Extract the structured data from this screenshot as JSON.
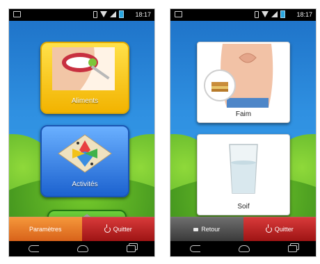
{
  "left_screen": {
    "status_time": "18:17",
    "tiles": [
      {
        "label": "Aliments"
      },
      {
        "label": "Activités"
      }
    ],
    "bottom_bar": {
      "left_label": "Paramètres",
      "right_label": "Quitter"
    }
  },
  "right_screen": {
    "status_time": "18:17",
    "tiles": [
      {
        "label": "Faim"
      },
      {
        "label": "Soif"
      }
    ],
    "bottom_bar": {
      "left_label": "Retour",
      "right_label": "Quitter"
    }
  },
  "colors": {
    "sky": "#2f90e1",
    "hills": "#3f9f1f",
    "aliments_tile": "#f7c81a",
    "activites_tile": "#2a72d8",
    "parametres_button": "#e57a28",
    "quitter_button": "#b52020",
    "retour_button": "#4e4e4e"
  },
  "icons": [
    "vibrate-icon",
    "wifi-icon",
    "signal-icon",
    "battery-icon",
    "power-icon",
    "back-arrow-icon",
    "home-icon",
    "recent-apps-icon"
  ]
}
